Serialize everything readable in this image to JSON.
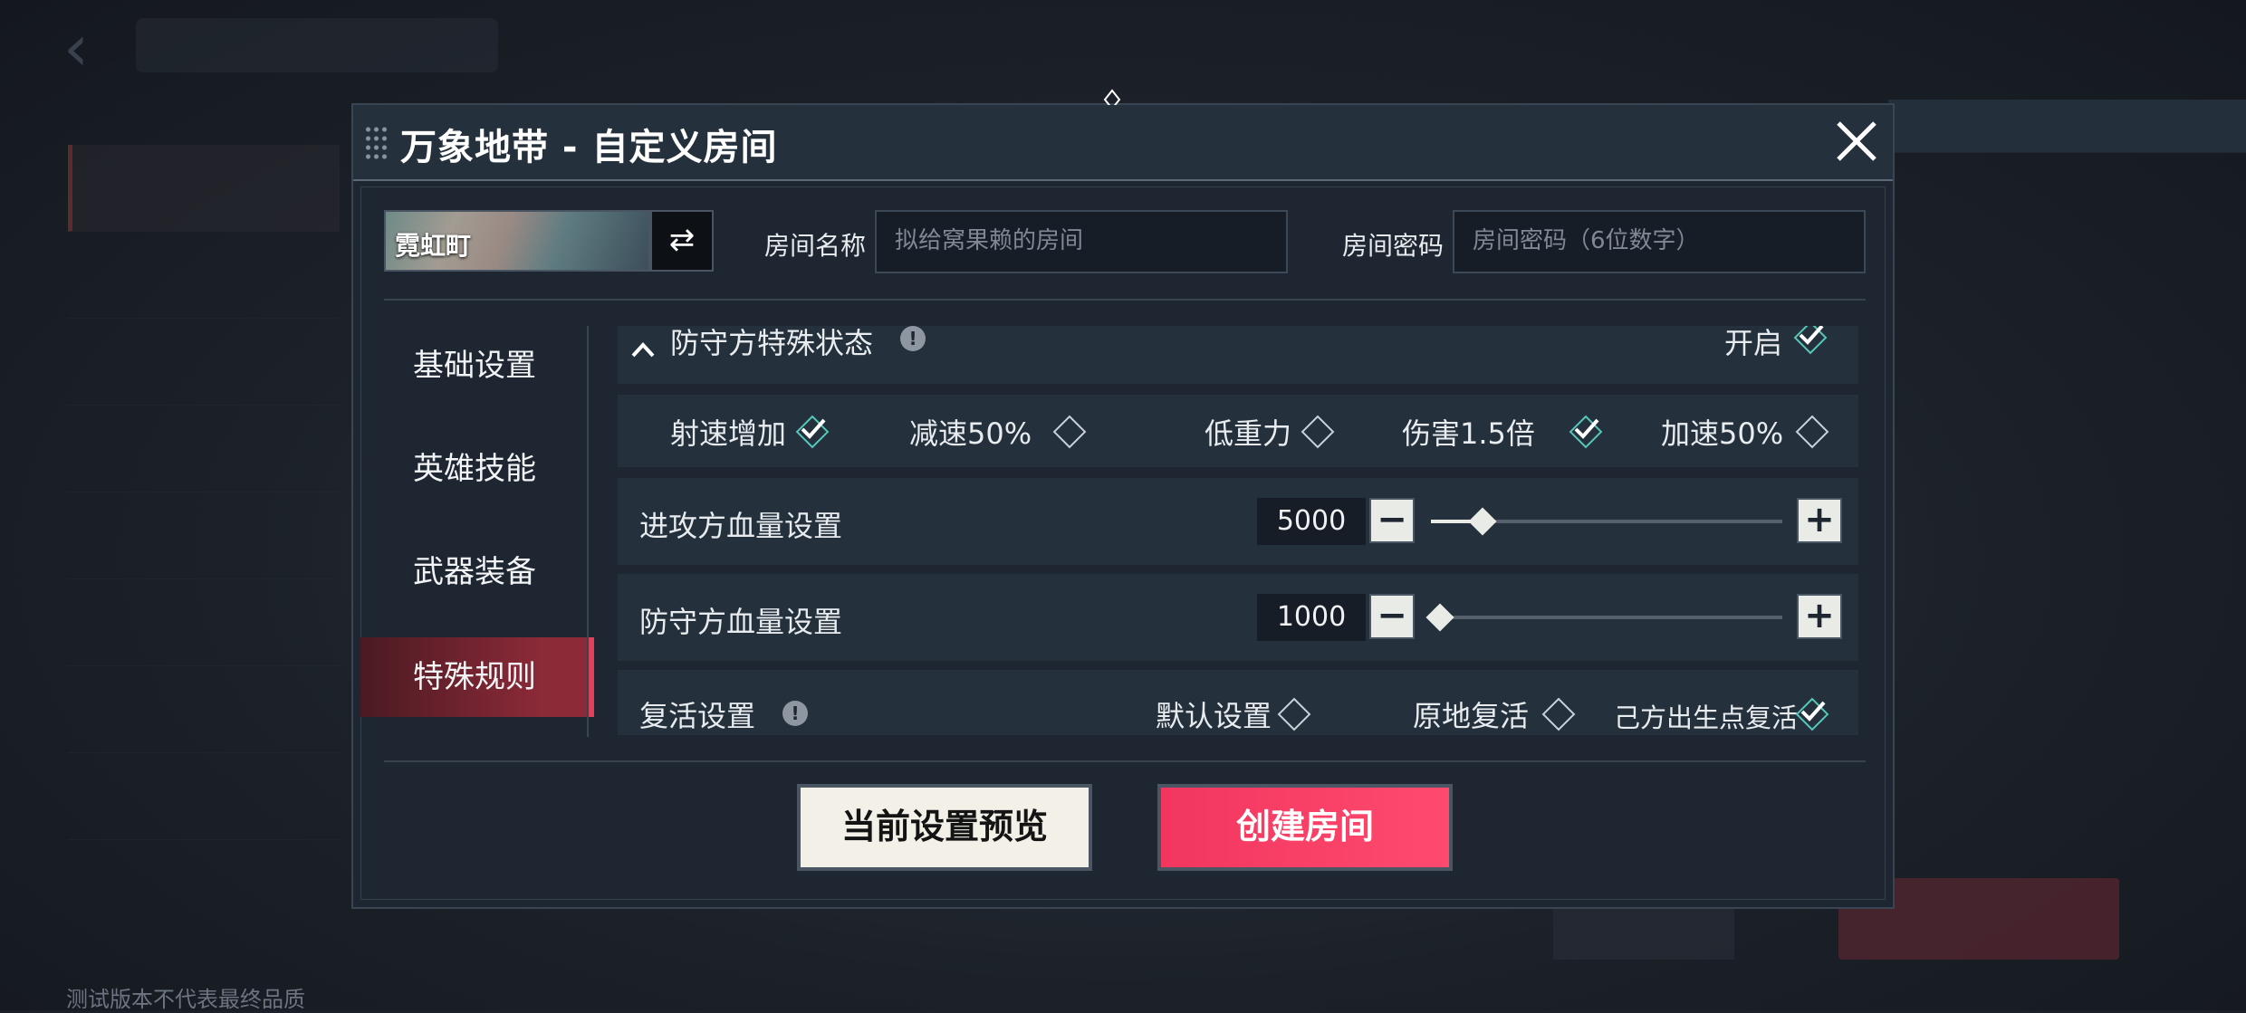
{
  "footer_note": "测试版本不代表最终品质",
  "dialog": {
    "title": "万象地带 - 自定义房间",
    "map_name": "霓虹町",
    "swap_icon": "⇄",
    "room_name_label": "房间名称",
    "room_name_placeholder": "拟给窝果赖的房间",
    "room_password_label": "房间密码",
    "room_password_placeholder": "房间密码（6位数字）"
  },
  "nav": {
    "items": [
      {
        "label": "基础设置",
        "active": false
      },
      {
        "label": "英雄技能",
        "active": false
      },
      {
        "label": "武器装备",
        "active": false
      },
      {
        "label": "特殊规则",
        "active": true
      }
    ]
  },
  "special_rules": {
    "defender_status": {
      "title": "防守方特殊状态",
      "toggle_label": "开启",
      "enabled": true,
      "options": [
        {
          "label": "射速增加",
          "checked": true
        },
        {
          "label": "减速50%",
          "checked": false
        },
        {
          "label": "低重力",
          "checked": false
        },
        {
          "label": "伤害1.5倍",
          "checked": true
        },
        {
          "label": "加速50%",
          "checked": false
        }
      ]
    },
    "attacker_hp": {
      "label": "进攻方血量设置",
      "value": "5000",
      "fill_fraction": 0.12
    },
    "defender_hp": {
      "label": "防守方血量设置",
      "value": "1000",
      "fill_fraction": 0.0
    },
    "revive": {
      "label": "复活设置",
      "options": [
        {
          "label": "默认设置",
          "checked": false
        },
        {
          "label": "原地复活",
          "checked": false
        },
        {
          "label": "己方出生点复活",
          "checked": true
        }
      ]
    }
  },
  "buttons": {
    "preview_label": "当前设置预览",
    "create_label": "创建房间"
  },
  "colors": {
    "accent_pink": "#f2365f",
    "check_teal": "#56c7b8",
    "nav_active": "#8c2a38"
  }
}
